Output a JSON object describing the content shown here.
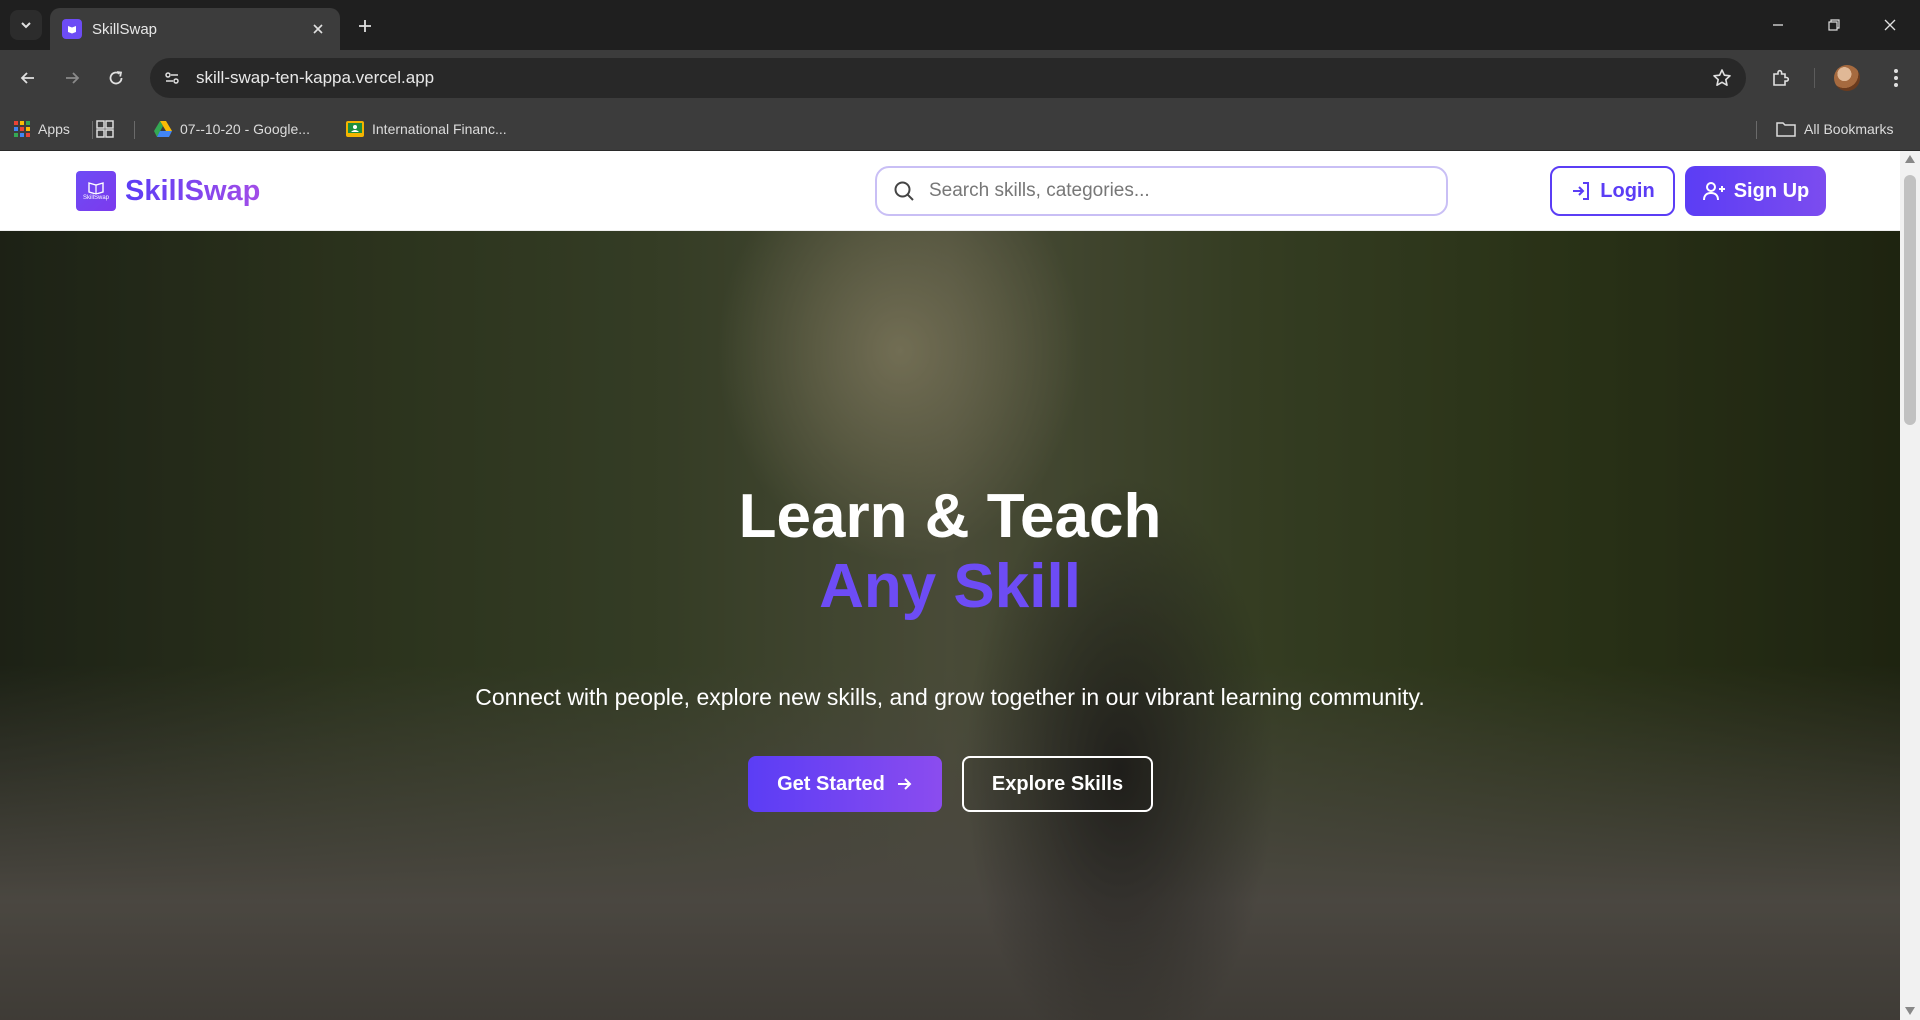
{
  "browser": {
    "tab_title": "SkillSwap",
    "url": "skill-swap-ten-kappa.vercel.app",
    "bookmarks": [
      {
        "label": "Apps",
        "icon": "apps-grid-icon"
      },
      {
        "label": "07--10-20 - Google...",
        "icon": "google-drive-icon"
      },
      {
        "label": "International Financ...",
        "icon": "google-classroom-icon"
      }
    ],
    "all_bookmarks_label": "All Bookmarks"
  },
  "site": {
    "brand": "SkillSwap",
    "brand_mark_text": "SkillSwap",
    "search_placeholder": "Search skills, categories...",
    "login_label": "Login",
    "signup_label": "Sign Up"
  },
  "hero": {
    "title_line1": "Learn & Teach",
    "title_line2": "Any Skill",
    "subtitle": "Connect with people, explore new skills, and grow together in our vibrant learning community.",
    "primary_cta": "Get Started",
    "secondary_cta": "Explore Skills"
  },
  "colors": {
    "brand_primary": "#5b3df5",
    "brand_accent": "#8b4cef",
    "chrome_dark": "#1f1f1f",
    "chrome_mid": "#3c3c3c"
  }
}
